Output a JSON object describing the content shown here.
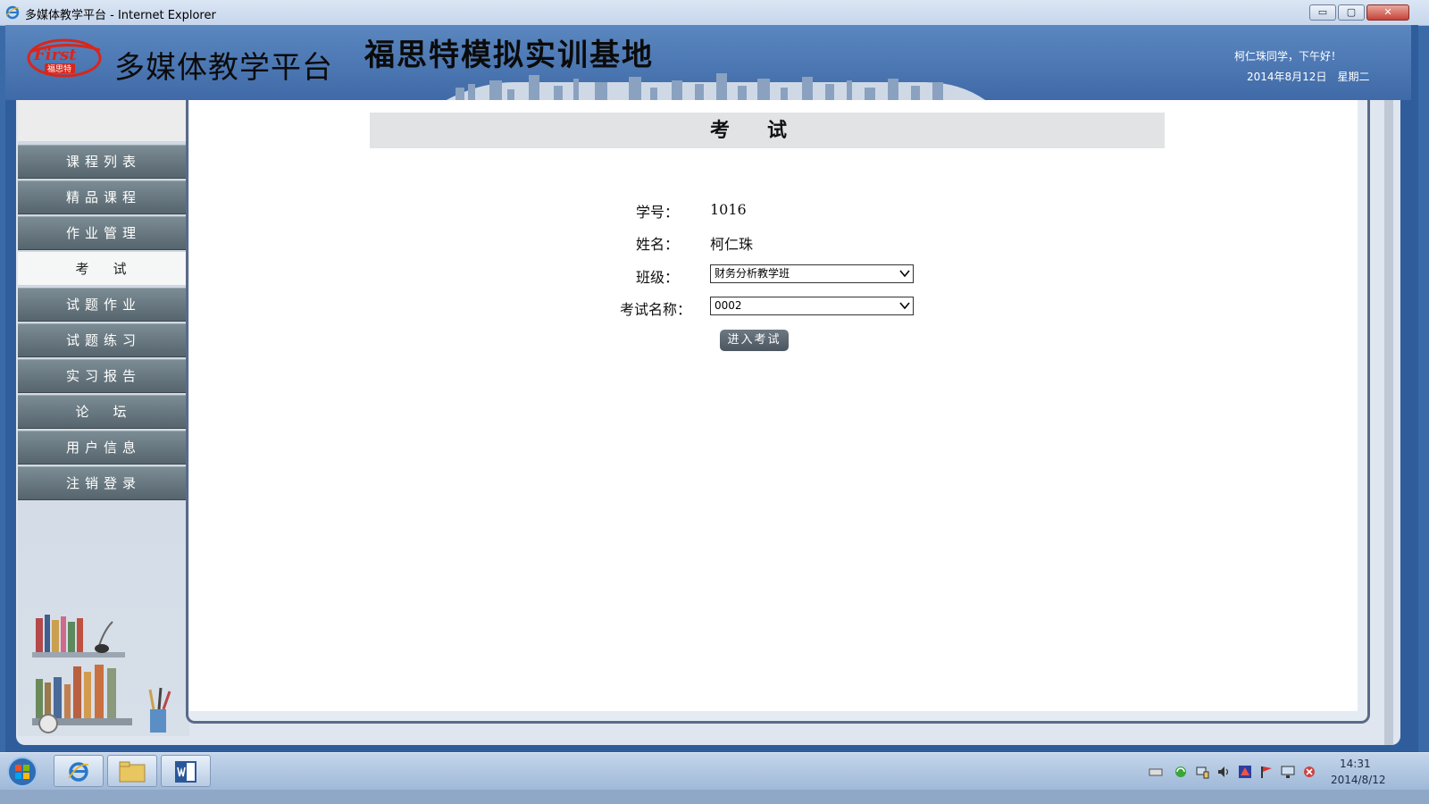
{
  "window": {
    "title": "多媒体教学平台 - Internet Explorer",
    "min_label": "▭",
    "max_label": "▢",
    "close_label": "✕"
  },
  "header": {
    "logo_text": "First",
    "logo_sub": "福思特",
    "site_title": "多媒体教学平台",
    "base_title": "福思特模拟实训基地",
    "greeting": "柯仁珠同学，下午好！",
    "date": "2014年8月12日　星期二"
  },
  "sidebar": {
    "items": [
      {
        "label": "课程列表"
      },
      {
        "label": "精品课程"
      },
      {
        "label": "作业管理"
      },
      {
        "label": "考　试"
      },
      {
        "label": "试题作业"
      },
      {
        "label": "试题练习"
      },
      {
        "label": "实习报告"
      },
      {
        "label": "论　坛"
      },
      {
        "label": "用户信息"
      },
      {
        "label": "注销登录"
      }
    ],
    "active_index": 3
  },
  "main": {
    "heading": "考试",
    "student_id_label": "学号：",
    "student_id": "1016",
    "name_label": "姓名：",
    "name": "柯仁珠",
    "class_label": "班级：",
    "class_value": "财务分析教学班",
    "exam_label": "考试名称：",
    "exam_value": "0002",
    "enter_button": "进入考试"
  },
  "taskbar": {
    "time": "14:31",
    "date": "2014/8/12",
    "apps": [
      "internet-explorer",
      "file-explorer",
      "word"
    ]
  },
  "colors": {
    "header_blue": "#4a76b2",
    "nav_gray": "#64737b",
    "button_dark": "#56626c"
  }
}
